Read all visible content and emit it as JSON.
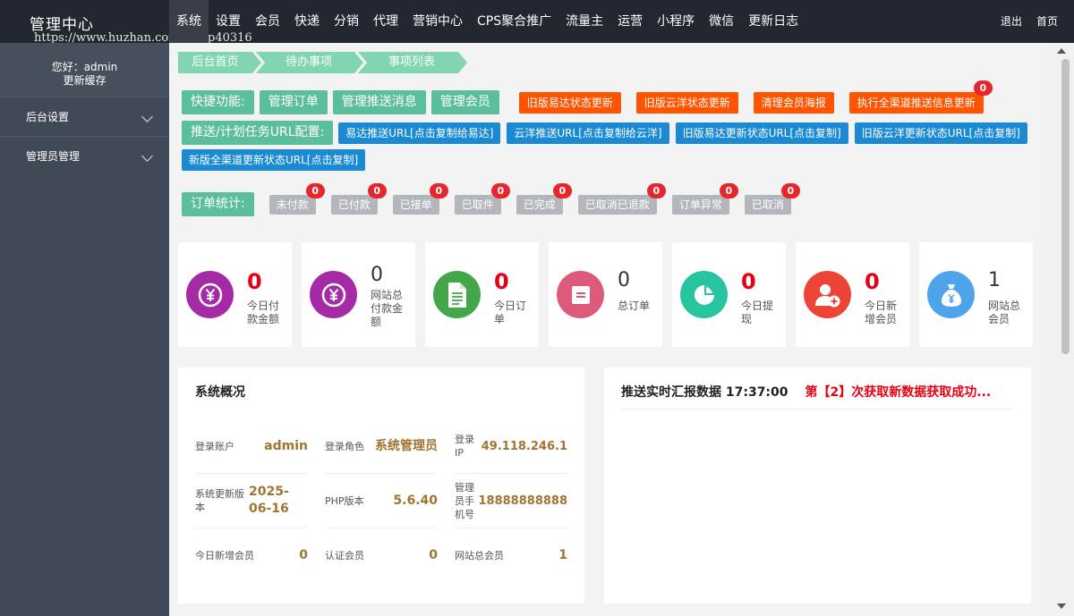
{
  "brand": {
    "title": "管理中心",
    "watermark": "https://www.huzhan.com/ishop40316"
  },
  "nav": {
    "items": [
      "系统",
      "设置",
      "会员",
      "快递",
      "分销",
      "代理",
      "营销中心",
      "CPS聚合推广",
      "流量主",
      "运营",
      "小程序",
      "微信",
      "更新日志"
    ],
    "active": "系统"
  },
  "topRight": {
    "logout": "退出",
    "home": "首页"
  },
  "sidebar": {
    "greeting": "您好：admin",
    "refresh": "更新缓存",
    "items": [
      "后台设置",
      "管理员管理"
    ]
  },
  "breadcrumb": [
    "后台首页",
    "待办事项",
    "事项列表"
  ],
  "quick": {
    "label": "快捷功能:",
    "greenButtons": [
      "管理订单",
      "管理推送消息",
      "管理会员"
    ],
    "orangeButtons": [
      {
        "label": "旧版易达状态更新",
        "badge": ""
      },
      {
        "label": "旧版云洋状态更新",
        "badge": ""
      },
      {
        "label": "清理会员海报",
        "badge": ""
      },
      {
        "label": "执行全渠道推送信息更新",
        "badge": "0"
      }
    ]
  },
  "push": {
    "label": "推送/计划任务URL配置:",
    "buttons": [
      "易达推送URL[点击复制给易达]",
      "云洋推送URL[点击复制给云洋]",
      "旧版易达更新状态URL[点击复制]",
      "旧版云洋更新状态URL[点击复制]",
      "新版全渠道更新状态URL[点击复制]"
    ]
  },
  "orderStats": {
    "label": "订单统计:",
    "items": [
      {
        "label": "未付款",
        "badge": "0"
      },
      {
        "label": "已付款",
        "badge": "0"
      },
      {
        "label": "已接单",
        "badge": "0"
      },
      {
        "label": "已取件",
        "badge": "0"
      },
      {
        "label": "已完成",
        "badge": "0"
      },
      {
        "label": "已取消已退款",
        "badge": "0"
      },
      {
        "label": "订单异常",
        "badge": "0"
      },
      {
        "label": "已取消",
        "badge": "0"
      }
    ]
  },
  "stats": [
    {
      "value": "0",
      "label": "今日付款金额",
      "icon": "yen-icon",
      "color": "#a52aa6",
      "highlight": true
    },
    {
      "value": "0",
      "label": "网站总付款金额",
      "icon": "yen-icon",
      "color": "#a52aa6",
      "highlight": false
    },
    {
      "value": "0",
      "label": "今日订单",
      "icon": "document-icon",
      "color": "#43a74a",
      "highlight": true
    },
    {
      "value": "0",
      "label": "总订单",
      "icon": "list-icon",
      "color": "#de5a7a",
      "highlight": false
    },
    {
      "value": "0",
      "label": "今日提现",
      "icon": "pie-chart-icon",
      "color": "#27c4a0",
      "highlight": true
    },
    {
      "value": "0",
      "label": "今日新增会员",
      "icon": "add-user-icon",
      "color": "#ec4437",
      "highlight": true
    },
    {
      "value": "1",
      "label": "网站总会员",
      "icon": "money-bag-icon",
      "color": "#4ea4ea",
      "highlight": false
    }
  ],
  "system": {
    "title": "系统概况",
    "rows": [
      [
        {
          "key": "登录账户",
          "value": "admin"
        },
        {
          "key": "登录角色",
          "value": "系统管理员"
        },
        {
          "key": "登录IP",
          "value": "49.118.246.1"
        }
      ],
      [
        {
          "key": "系统更新版本",
          "value": "2025-06-16"
        },
        {
          "key": "PHP版本",
          "value": "5.6.40"
        },
        {
          "key": "管理员手机号",
          "value": "18888888888"
        }
      ],
      [
        {
          "key": "今日新增会员",
          "value": "0"
        },
        {
          "key": "认证会员",
          "value": "0"
        },
        {
          "key": "网站总会员",
          "value": "1"
        }
      ]
    ]
  },
  "pushReport": {
    "title": "推送实时汇报数据 17:37:00",
    "status": "第【2】次获取新数据获取成功..."
  }
}
